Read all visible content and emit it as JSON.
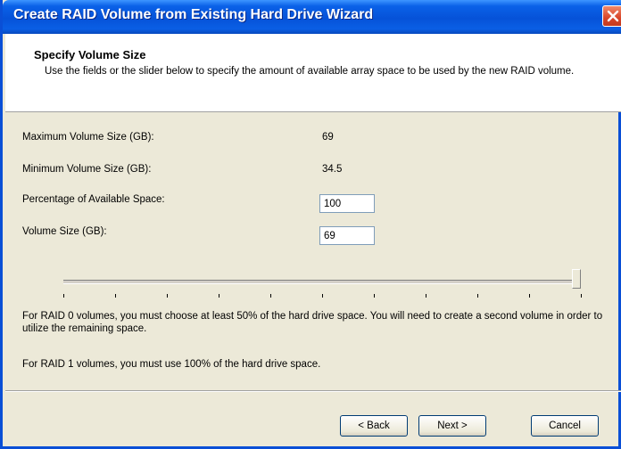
{
  "window": {
    "title": "Create RAID Volume from Existing Hard Drive Wizard"
  },
  "header": {
    "title": "Specify Volume Size",
    "description": "Use the fields or the slider below to specify the amount of available array space to be used by the new RAID volume."
  },
  "form": {
    "max_label": "Maximum Volume Size (GB):",
    "max_value": "69",
    "min_label": "Minimum Volume Size (GB):",
    "min_value": "34.5",
    "percent_label": "Percentage of Available Space:",
    "percent_value": "100",
    "size_label": "Volume Size (GB):",
    "size_value": "69"
  },
  "slider": {
    "value_percent": 100,
    "tick_count": 11
  },
  "notes": {
    "raid0": "For RAID 0 volumes, you must choose at least 50% of the hard drive space. You will need to create a second volume in order to utilize the remaining space.",
    "raid1": "For RAID 1 volumes, you must use 100% of the hard drive space."
  },
  "buttons": {
    "back": "< Back",
    "next": "Next >",
    "cancel": "Cancel"
  }
}
